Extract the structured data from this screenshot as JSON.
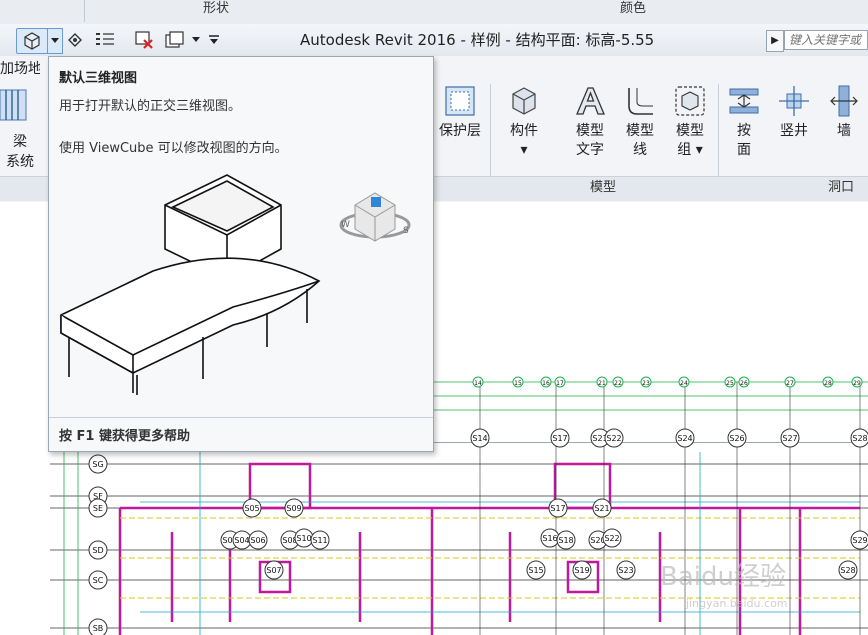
{
  "top_strip": {
    "left_label": "形状",
    "right_label": "颜色"
  },
  "title_bar": {
    "title": "Autodesk Revit 2016 -    样例 - 结构平面: 标高-5.55",
    "search_placeholder": "键入关键字或"
  },
  "ribbon": {
    "left_partial": {
      "tab_text": "加场地",
      "beam_label_1": "梁",
      "beam_label_2": "系统"
    },
    "tools": [
      {
        "label_1": "保护层",
        "label_2": ""
      },
      {
        "label_1": "构件",
        "label_2": "▾"
      },
      {
        "label_1": "模型",
        "label_2": "文字"
      },
      {
        "label_1": "模型",
        "label_2": "线"
      },
      {
        "label_1": "模型",
        "label_2": "组 ▾"
      },
      {
        "label_1": "按",
        "label_2": "面"
      },
      {
        "label_1": "竖井",
        "label_2": ""
      },
      {
        "label_1": "墙",
        "label_2": ""
      }
    ],
    "panels": {
      "model": "模型",
      "opening": "洞口"
    }
  },
  "tooltip": {
    "title": "默认三维视图",
    "description": "用于打开默认的正交三维视图。",
    "extra": "使用 ViewCube 可以修改视图的方向。",
    "help": "按 F1 键获得更多帮助"
  },
  "drawing": {
    "top_axis_labels": [
      "14",
      "15",
      "16",
      "17",
      "21",
      "22",
      "23",
      "24",
      "25",
      "26",
      "27",
      "28",
      "29"
    ],
    "side_axis_labels": [
      "SG",
      "SF",
      "SE",
      "SD",
      "SC",
      "SB"
    ],
    "column_tags": [
      "S14",
      "S17",
      "S21",
      "S22",
      "S24",
      "S26",
      "S27",
      "S28",
      "S05",
      "S09",
      "S17",
      "S21",
      "S03",
      "S04",
      "S06",
      "S08",
      "S10",
      "S11",
      "S16",
      "S18",
      "S20",
      "S22",
      "S07",
      "S15",
      "S19",
      "S23",
      "S28",
      "S29"
    ],
    "watermark": "Baidu经验",
    "watermark_sub": "jingyan.baidu.com"
  },
  "colors": {
    "grid_green": "#19b34a",
    "wall_magenta": "#c0199b",
    "dim_cyan": "#17a9c4",
    "beam_yellow": "#d8c91a"
  },
  "icons": [
    "default-3d-view-icon",
    "thin-lines-icon",
    "close-hidden-icon",
    "switch-windows-icon",
    "cover-icon",
    "component-icon",
    "model-text-icon",
    "model-line-icon",
    "model-group-icon",
    "by-face-icon",
    "shaft-icon",
    "wall-opening-icon"
  ]
}
